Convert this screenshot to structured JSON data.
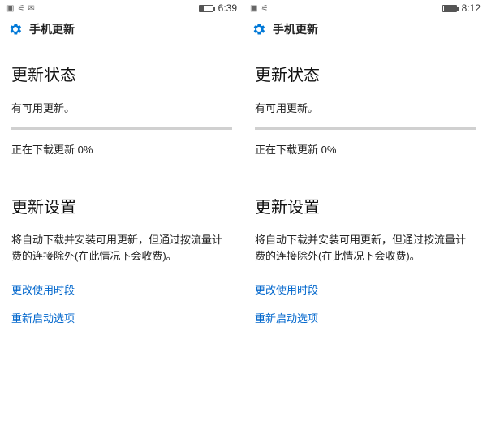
{
  "left": {
    "time": "6:39",
    "battery_fill_pct": 30,
    "header_title": "手机更新",
    "section_status_title": "更新状态",
    "status_text": "有可用更新。",
    "download_text": "正在下载更新 0%",
    "section_settings_title": "更新设置",
    "settings_desc": "将自动下载并安装可用更新，但通过按流量计费的连接除外(在此情况下会收费)。",
    "link_change_hours": "更改使用时段",
    "link_restart_options": "重新启动选项"
  },
  "right": {
    "time": "8:12",
    "battery_fill_pct": 95,
    "header_title": "手机更新",
    "section_status_title": "更新状态",
    "status_text": "有可用更新。",
    "download_text": "正在下载更新 0%",
    "section_settings_title": "更新设置",
    "settings_desc": "将自动下载并安装可用更新，但通过按流量计费的连接除外(在此情况下会收费)。",
    "link_change_hours": "更改使用时段",
    "link_restart_options": "重新启动选项"
  }
}
